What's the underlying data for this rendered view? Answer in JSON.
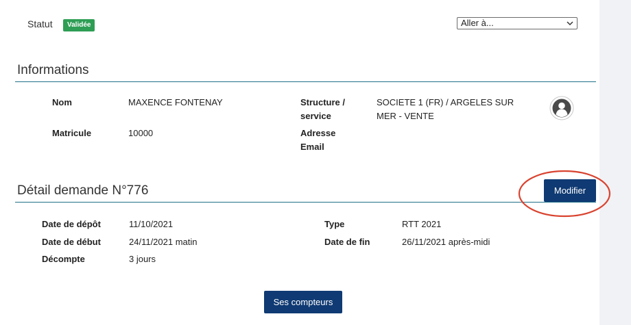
{
  "status": {
    "label": "Statut",
    "badge": "Validée",
    "badge_color": "#2e9e55"
  },
  "goto": {
    "selected": "Aller à...",
    "icon": "chevron-down-icon"
  },
  "informations": {
    "title": "Informations",
    "name_label": "Nom",
    "name_value": "MAXENCE FONTENAY",
    "id_label": "Matricule",
    "id_value": "10000",
    "structure_label_1": "Structure /",
    "structure_label_2": "service",
    "structure_value_1": "SOCIETE 1 (FR) / ARGELES SUR",
    "structure_value_2": "MER - VENTE",
    "email_label_1": "Adresse",
    "email_label_2": "Email",
    "email_value": "",
    "avatar_icon": "user-avatar-icon"
  },
  "detail": {
    "title": "Détail demande N°776",
    "modify_button": "Modifier",
    "submit_date_label": "Date de dépôt",
    "submit_date_value": "11/10/2021",
    "type_label": "Type",
    "type_value": "RTT 2021",
    "start_label": "Date de début",
    "start_value": "24/11/2021 matin",
    "end_label": "Date de fin",
    "end_value": "26/11/2021 après-midi",
    "count_label": "Décompte",
    "count_value": "3 jours"
  },
  "counters_button": "Ses compteurs",
  "colors": {
    "primary_button": "#0f3a73",
    "rule": "#1f6f87",
    "highlight": "#d9432f"
  }
}
